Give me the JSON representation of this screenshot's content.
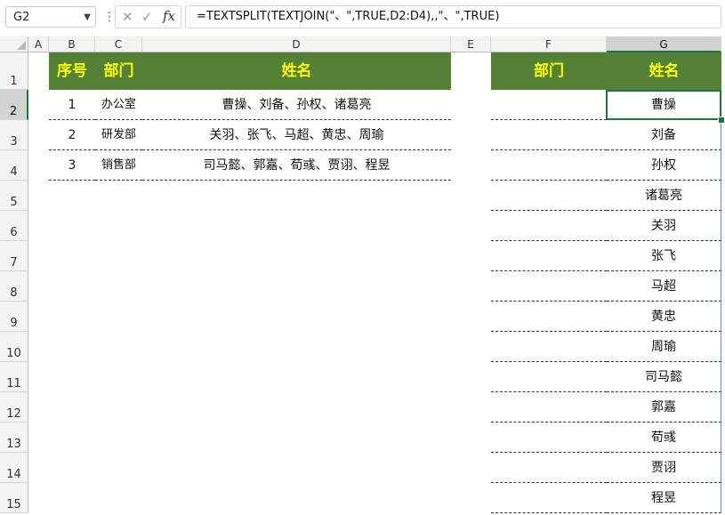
{
  "formula_bar": {
    "name_box": "G2",
    "formula": "=TEXTSPLIT(TEXTJOIN(\"、\",TRUE,D2:D4),,\"、\",TRUE)"
  },
  "columns": [
    "A",
    "B",
    "C",
    "D",
    "E",
    "F",
    "G"
  ],
  "rows": [
    "1",
    "2",
    "3",
    "4",
    "5",
    "6",
    "7",
    "8",
    "9",
    "10",
    "11",
    "12",
    "13",
    "14",
    "15"
  ],
  "left_table": {
    "headers": {
      "seq": "序号",
      "dept": "部门",
      "names": "姓名"
    },
    "rows": [
      {
        "seq": "1",
        "dept": "办公室",
        "names": "曹操、刘备、孙权、诸葛亮"
      },
      {
        "seq": "2",
        "dept": "研发部",
        "names": "关羽、张飞、马超、黄忠、周瑜"
      },
      {
        "seq": "3",
        "dept": "销售部",
        "names": "司马懿、郭嘉、荀彧、贾诩、程昱"
      }
    ]
  },
  "right_table": {
    "headers": {
      "dept": "部门",
      "name": "姓名"
    },
    "names": [
      "曹操",
      "刘备",
      "孙权",
      "诸葛亮",
      "关羽",
      "张飞",
      "马超",
      "黄忠",
      "周瑜",
      "司马懿",
      "郭嘉",
      "荀彧",
      "贾诩",
      "程昱"
    ]
  },
  "colors": {
    "header_bg": "#538135",
    "header_text": "#FFFF00",
    "selection": "#217346"
  }
}
